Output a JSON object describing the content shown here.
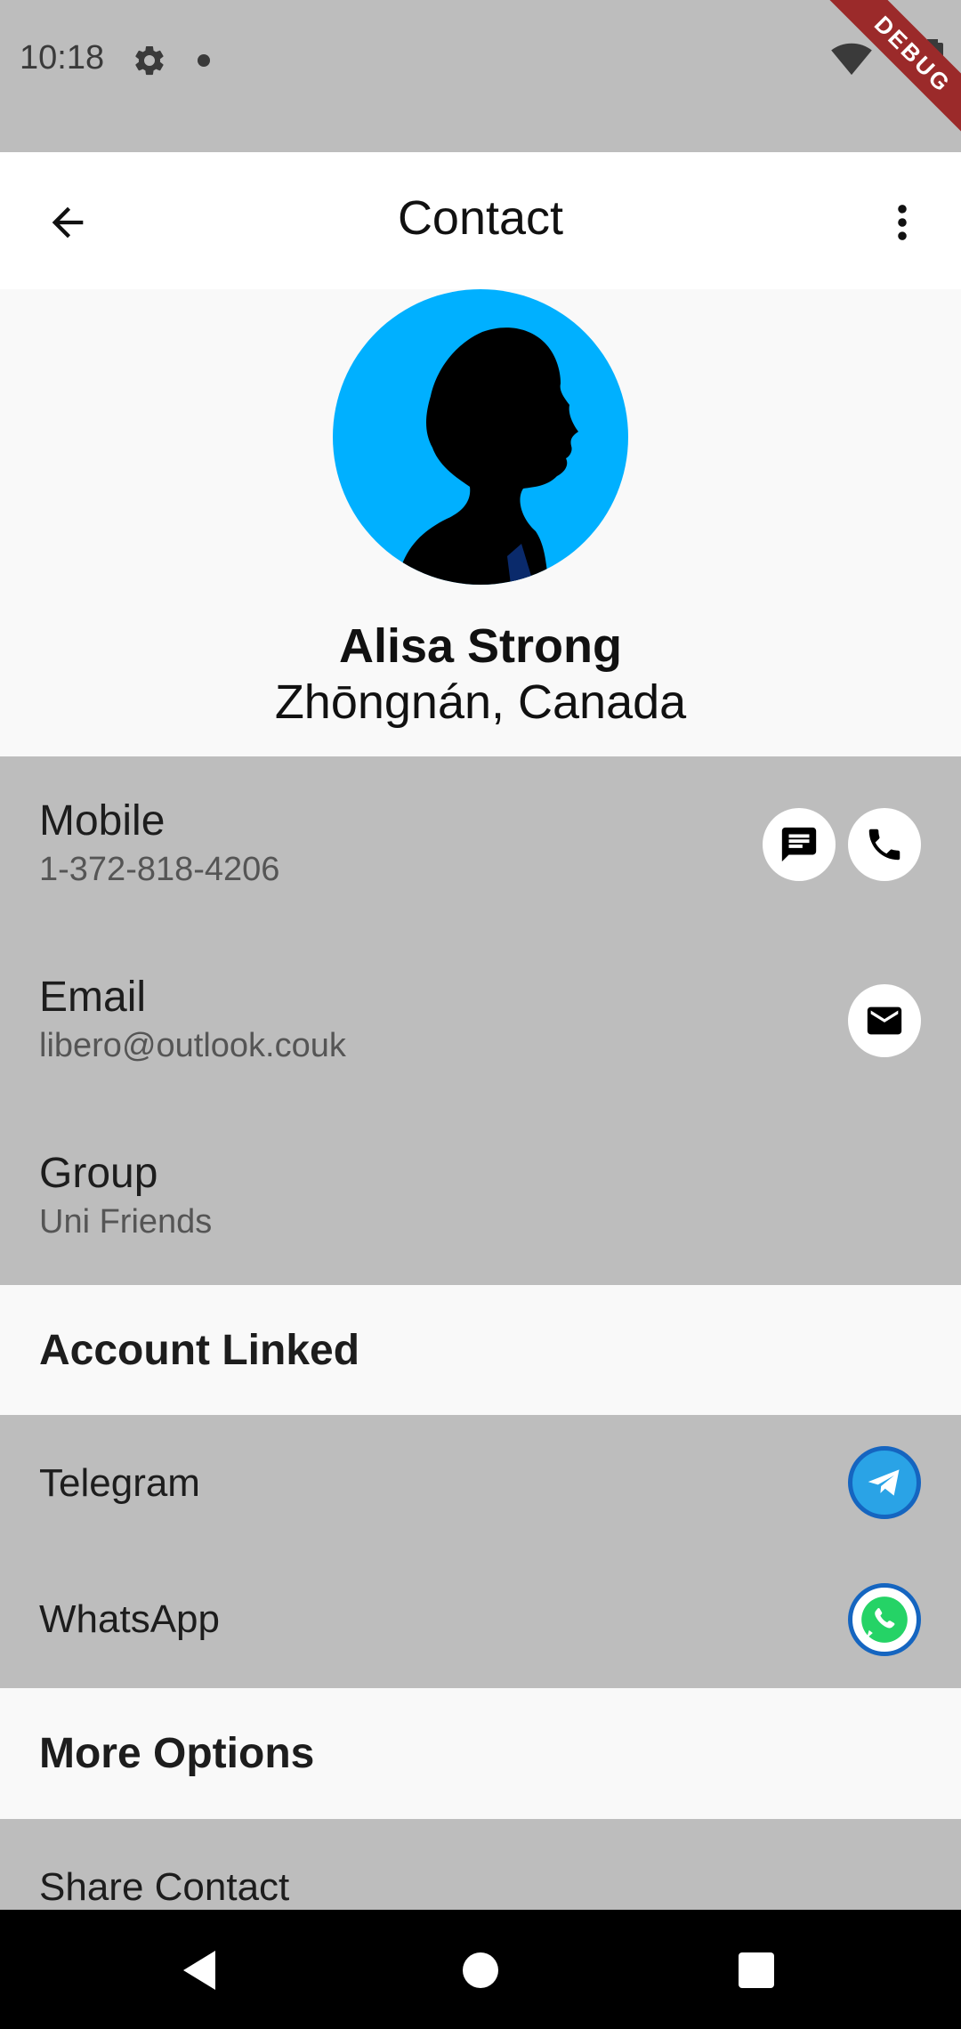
{
  "status_bar": {
    "time": "10:18",
    "debug_label": "DEBUG"
  },
  "app_bar": {
    "title": "Contact"
  },
  "contact": {
    "name": "Alisa Strong",
    "location": "Zhōngnán, Canada"
  },
  "details": [
    {
      "label": "Mobile",
      "value": "1-372-818-4206"
    },
    {
      "label": "Email",
      "value": "libero@outlook.couk"
    },
    {
      "label": "Group",
      "value": "Uni Friends"
    }
  ],
  "accounts": {
    "header": "Account Linked",
    "items": [
      {
        "label": "Telegram",
        "icon": "telegram-icon",
        "color": "#2aa3e6"
      },
      {
        "label": "WhatsApp",
        "icon": "whatsapp-icon",
        "color": "#25d366"
      }
    ]
  },
  "options": {
    "header": "More Options",
    "items": [
      {
        "label": "Share Contact"
      }
    ]
  },
  "colors": {
    "avatar_bg": "#00b0ff",
    "section_grey": "#bdbdbd",
    "debug_ribbon": "#9b2a2a"
  }
}
